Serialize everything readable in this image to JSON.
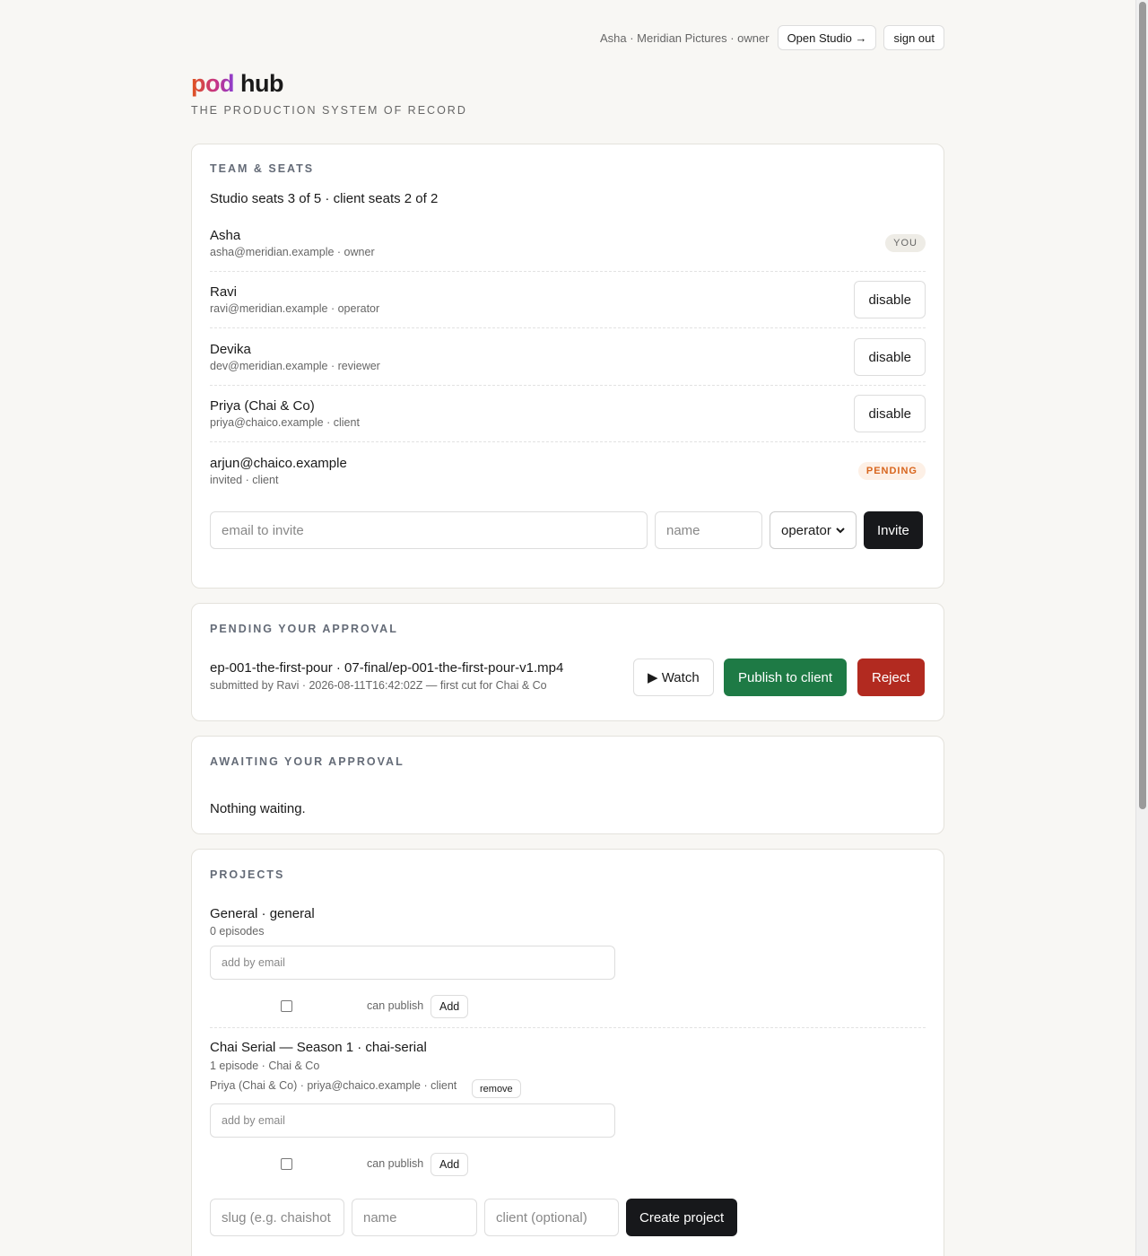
{
  "header": {
    "user_info": "Asha · Meridian Pictures · owner",
    "open_studio": "Open Studio →",
    "sign_out": "sign out",
    "logo_pod": "pod",
    "logo_hub": "hub",
    "tagline": "THE PRODUCTION SYSTEM OF RECORD"
  },
  "team": {
    "title": "TEAM & SEATS",
    "summary": "Studio seats 3 of 5 · client seats 2 of 2",
    "members": [
      {
        "name": "Asha",
        "meta": "asha@meridian.example · owner",
        "badge": "YOU"
      },
      {
        "name": "Ravi",
        "meta": "ravi@meridian.example · operator",
        "action": "disable"
      },
      {
        "name": "Devika",
        "meta": "dev@meridian.example · reviewer",
        "action": "disable"
      },
      {
        "name": "Priya (Chai & Co)",
        "meta": "priya@chaico.example · client",
        "action": "disable"
      },
      {
        "name": "arjun@chaico.example",
        "meta": "invited · client",
        "badge": "PENDING"
      }
    ],
    "invite": {
      "email_placeholder": "email to invite",
      "name_placeholder": "name",
      "role_value": "operator",
      "button": "Invite"
    }
  },
  "pending": {
    "title": "PENDING YOUR APPROVAL",
    "item_title": "ep-001-the-first-pour · 07-final/ep-001-the-first-pour-v1.mp4",
    "item_meta": "submitted by Ravi · 2026-08-11T16:42:02Z — first cut for Chai & Co",
    "watch": "▶ Watch",
    "publish": "Publish to client",
    "reject": "Reject"
  },
  "awaiting": {
    "title": "AWAITING YOUR APPROVAL",
    "empty": "Nothing waiting."
  },
  "projects": {
    "title": "PROJECTS",
    "items": [
      {
        "title": "General · general",
        "meta": "0 episodes",
        "add_placeholder": "add by email",
        "can_publish": "can publish",
        "add": "Add"
      },
      {
        "title": "Chai Serial — Season 1 · chai-serial",
        "meta": "1 episode · Chai & Co",
        "member": "Priya (Chai & Co) · priya@chaico.example · client",
        "remove": "remove",
        "add_placeholder": "add by email",
        "can_publish": "can publish",
        "add": "Add"
      }
    ],
    "create": {
      "slug_placeholder": "slug (e.g. chaishot",
      "name_placeholder": "name",
      "client_placeholder": "client (optional)",
      "button": "Create project"
    }
  }
}
